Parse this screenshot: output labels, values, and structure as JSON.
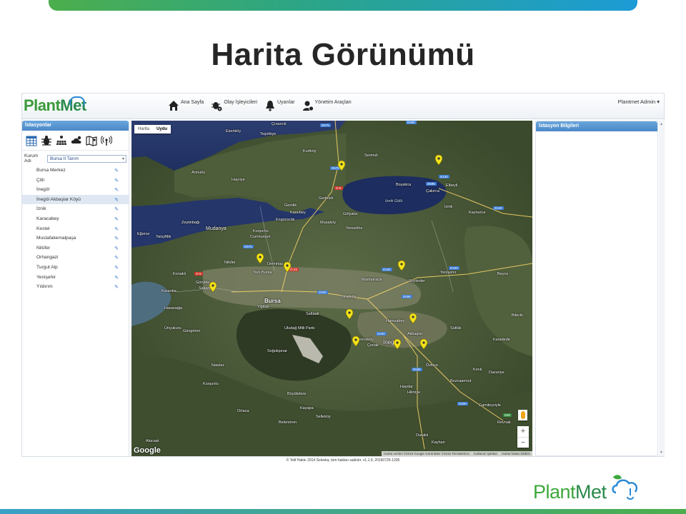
{
  "slide": {
    "title": "Harita Görünümü"
  },
  "app": {
    "logo_text_plant": "Plant",
    "logo_text_met": "Met",
    "nav": [
      {
        "label": "Ana Sayfa",
        "icon": "home-icon"
      },
      {
        "label": "Olay İşleyicileri",
        "icon": "bug-gear-icon"
      },
      {
        "label": "Uyarılar",
        "icon": "bell-icon"
      },
      {
        "label": "Yönetim Araçları",
        "icon": "user-settings-icon"
      }
    ],
    "user_menu": "Plantmet Admin ▾"
  },
  "left_panel": {
    "header": "İstasyonlar",
    "icons": [
      "calendar-table-icon",
      "bug-icon",
      "solar-panel-icon",
      "weather-icon",
      "map-icon",
      "antenna-icon"
    ],
    "kurum_label": "Kurum Adı",
    "kurum_value": "Bursa İl Tarım",
    "stations": [
      "Bursa Merkez",
      "Çitli",
      "İnegöl",
      "İnegöl Akbaşlar Köyü",
      "İznik",
      "Karacabey",
      "Kestel",
      "Mustafakemalpaşa",
      "Nilüfer",
      "Orhangazi",
      "Turgut Alp",
      "Yenişehir",
      "Yıldırım"
    ],
    "selected_index": 3
  },
  "map": {
    "type_buttons": [
      "Harita",
      "Uydu"
    ],
    "active_type": "Uydu",
    "google": "Google",
    "attribution": [
      "Harita verileri ©2016 Google Görüntüler ©2016 TerraMetrics",
      "Kullanım Şartları",
      "Harita hatası bildirin"
    ],
    "zoom_in": "+",
    "zoom_out": "−",
    "labels": {
      "esenkoy": "Esenköy",
      "tesvikiye": "Teşvikiye",
      "cinarcik": "Çınarcık",
      "kurtkoy": "Kurtköy",
      "armutlu": "Armutlu",
      "hayirye": "Hayriye",
      "sermuli": "Sermuli",
      "boyalica": "Boyalıca",
      "cakirca": "Çakırca",
      "elbeyli": "Elbeyli",
      "gedelek": "Gedelek",
      "izn_golu": "İznik Gölü",
      "iznik": "İznik",
      "kaynarca": "Kaynarca",
      "gemlik": "Gemlik",
      "karsibey": "Karsıbey",
      "engurucuk": "Engürücük",
      "golyaka": "Gölyaka",
      "zeytinbagi": "Zeytinbağı",
      "mudanya": "Mudanya",
      "kurslu": "Kurşunlu",
      "cumhuriyet": "Cumhuriyet",
      "musakoy": "Musaköy",
      "yenisolos": "Yenisölöz",
      "yalicifflik": "Yalıçiftlik",
      "egerce": "Eğerce",
      "yenisehir": "Yenişehir",
      "nilufer": "Nilüfer",
      "demirtas": "Demirtaş",
      "yenibursa": "Yeni Bursa",
      "konakli": "Konaklı",
      "gorukle": "Görükle",
      "sakarya": "Sakarya",
      "karaoba": "Karaoba",
      "hasanaga": "Hasanağa",
      "marmaracik": "Marmaracık",
      "soylenler": "Söylenler",
      "bursa": "Bursa",
      "yigitali": "Yiğitali",
      "saltaati": "Saltaati",
      "turanköy": "Turanköy",
      "uludag": "Uludağ Milli Parkı",
      "hamzabey": "Hamzabey",
      "akbaslar": "Akbaşlar",
      "inegol": "İnegöl",
      "yenikoy": "Yeniceköy",
      "ceriak": "Çeriak",
      "ozluce": "Özlüce",
      "sogukpinar": "Soğukpınar",
      "haydar": "Haydar",
      "hilmiye": "Hilmiye",
      "bozcaarmut": "Bozcaarmut",
      "kinik": "Kınık",
      "uncukuru": "Ünçükuru",
      "gungoren": "Güngören",
      "nasilar": "Nasılar",
      "kursunlu2": "Kurşunlu",
      "buyukdere": "Büyükdere",
      "ortaca": "Ortaca",
      "kayapa": "Kayapa",
      "sellekoy": "Selleköy",
      "belenoren": "Belenören",
      "alacaat": "Alacaat",
      "duraklı": "Duraklı",
      "kayhan": "Kayhan",
      "bilecik": "Bilecik",
      "karadede": "Karadede",
      "dazariye": "Dazariye",
      "cambeyli": "Camileyviyle",
      "revnak": "Revnak",
      "sutluk": "Sütlük",
      "beyce": "Beyce"
    },
    "roads": [
      "D575",
      "D595",
      "D575",
      "O-5",
      "D595",
      "D150",
      "D130",
      "D575",
      "O-5",
      "O-22",
      "D200",
      "D160",
      "D160",
      "D200",
      "D595",
      "D595",
      "D200",
      "E90"
    ]
  },
  "right_panel": {
    "header": "İstasyon Bilgileri"
  },
  "footer": {
    "copyright": "© Telif Hakkı 2014 Solveka, tüm hakları saklıdır. v1.1.9, 20160725-1205"
  },
  "slide_logo": {
    "plant": "Plant",
    "met": "Met"
  },
  "colors": {
    "accent_green": "#4cae4c",
    "accent_blue": "#1c9bd6",
    "panel_header": "#4a88c8",
    "marker_yellow": "#f2e21a"
  }
}
